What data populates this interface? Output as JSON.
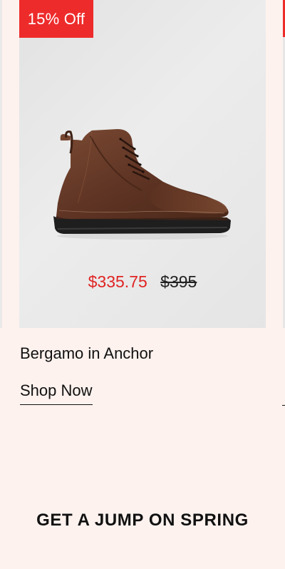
{
  "product_card": {
    "badge": "15% Off",
    "image_alt": "brown leather lace-up boot",
    "price_sale": "$335.75",
    "price_original": "$395",
    "name": "Bergamo in Anchor",
    "cta": "Shop Now"
  },
  "section": {
    "heading": "GET A JUMP ON SPRING"
  },
  "colors": {
    "background": "#fdf2ee",
    "badge": "#ee2b2b",
    "sale_price": "#e02424",
    "text": "#111111"
  }
}
